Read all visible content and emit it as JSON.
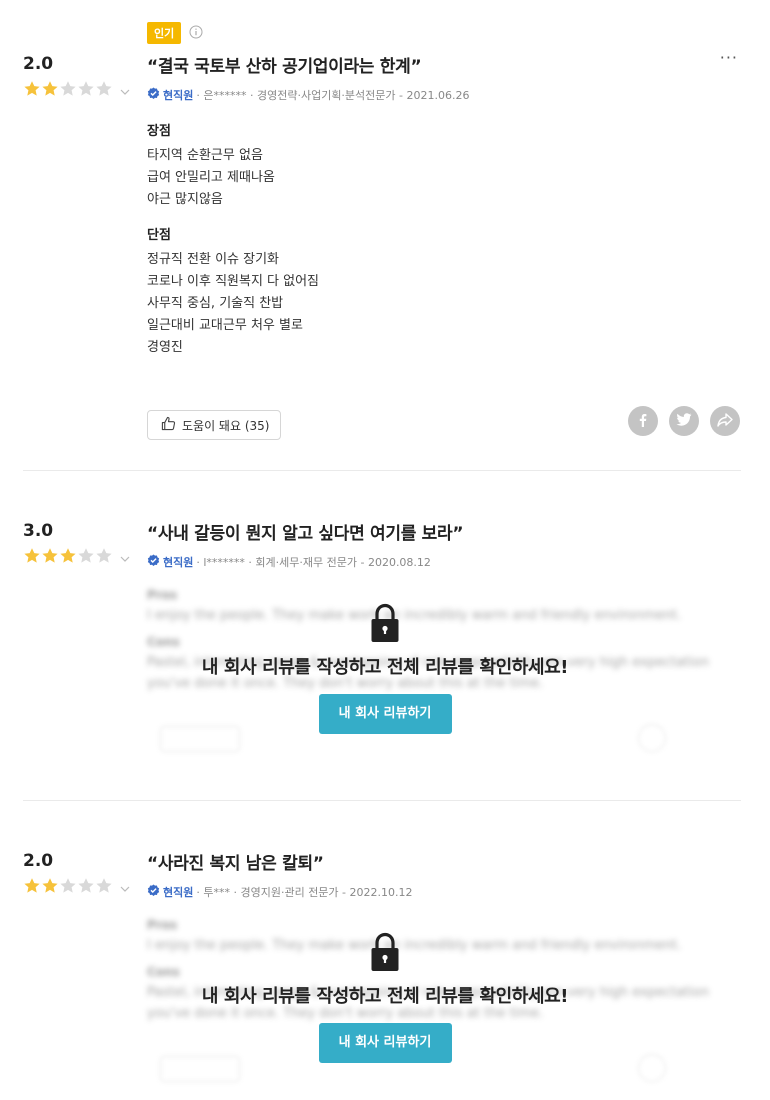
{
  "colors": {
    "star_filled": "#f6c23b",
    "star_empty": "#d9d9d9",
    "badge": "#f5b800",
    "cta": "#35adc8",
    "verified": "#3b6cc7"
  },
  "reviews": [
    {
      "popular_badge": "인기",
      "score": "2.0",
      "rating": 2,
      "title": "“결국 국토부 산하 공기업이라는 한계”",
      "verified_label": "현직원",
      "meta": "· 은****** · 경영전략·사업기획·분석전문가 - 2021.06.26",
      "pros_heading": "장점",
      "pros": [
        "타지역 순환근무 없음",
        "급여 안밀리고 제때나옴",
        "야근 많지않음"
      ],
      "cons_heading": "단점",
      "cons": [
        "정규직 전환 이슈 장기화",
        "코로나 이후 직원복지 다 없어짐",
        "사무직 중심, 기술직 찬밥",
        "일근대비 교대근무 처우 별로",
        "경영진"
      ],
      "helpful_label": "도움이 돼요 (35)",
      "more_label": "···"
    },
    {
      "score": "3.0",
      "rating": 3,
      "title": "“사내 갈등이 뭔지 알고 싶다면 여기를 보라”",
      "verified_label": "현직원",
      "meta": "· l******* · 회계·세무·재무 전문가 - 2020.08.12",
      "lock_message": "내 회사 리뷰를 작성하고 전체 리뷰를 확인하세요!",
      "cta_label": "내 회사 리뷰하기"
    },
    {
      "score": "2.0",
      "rating": 2,
      "title": "“사라진 복지 남은 칼퇴”",
      "verified_label": "현직원",
      "meta": "· 투*** · 경영지원·관리 전문가 - 2022.10.12",
      "lock_message": "내 회사 리뷰를 작성하고 전체 리뷰를 확인하세요!",
      "cta_label": "내 회사 리뷰하기"
    }
  ],
  "blurred_placeholder": {
    "pros_heading": "Pros",
    "pros_text": "I enjoy the people. They make work an incredibly warm and friendly environment.",
    "cons_heading": "Cons",
    "cons_text_1": "Pastel, interesting range & overlapping of role responsibility are very high expectation",
    "cons_text_2": "you've done it once. They don't worry about this at the time."
  }
}
